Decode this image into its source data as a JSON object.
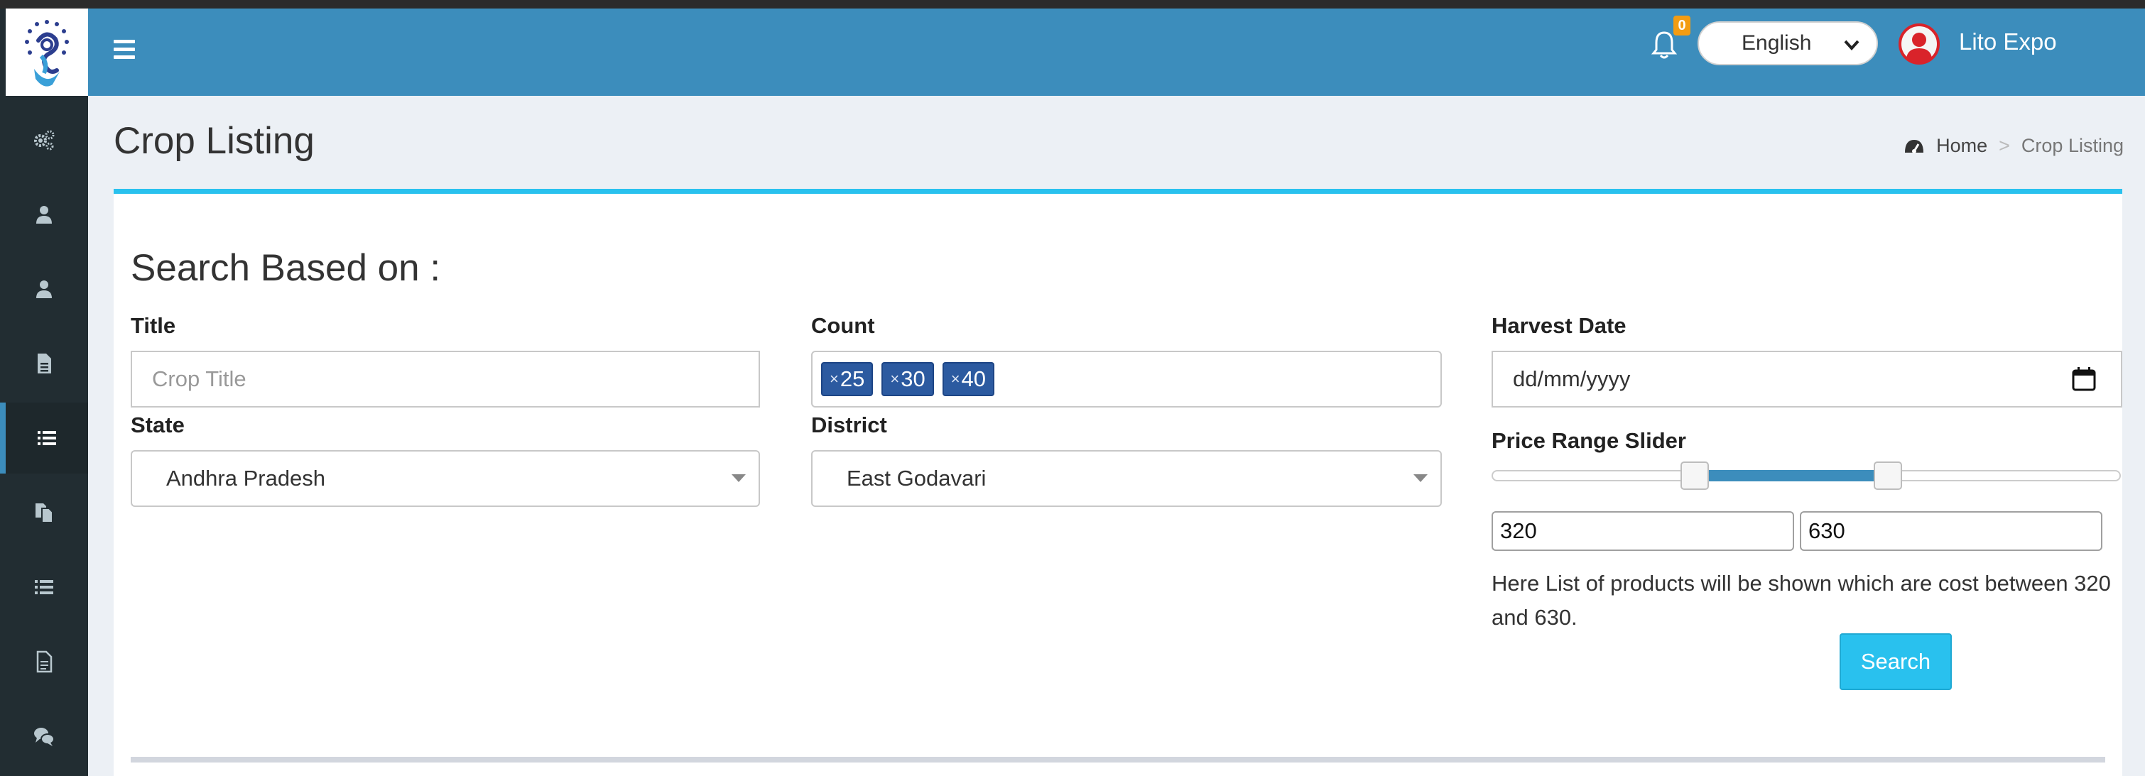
{
  "header": {
    "notification_count": "0",
    "language": "English",
    "user_name": "Lito Expo"
  },
  "page": {
    "title": "Crop Listing",
    "breadcrumb": [
      "Home",
      "Crop Listing"
    ]
  },
  "search": {
    "heading": "Search Based on :",
    "title_label": "Title",
    "title_placeholder": "Crop Title",
    "count_label": "Count",
    "count_chips": [
      "25",
      "30",
      "40"
    ],
    "harvest_label": "Harvest Date",
    "harvest_placeholder": "dd/mm/yyyy",
    "state_label": "State",
    "state_value": "Andhra Pradesh",
    "district_label": "District",
    "district_value": "East Godavari",
    "price_label": "Price Range Slider",
    "price_min": "320",
    "price_max": "630",
    "range_text": "Here List of products will be shown which are cost between 320 and 630.",
    "search_button": "Search"
  },
  "sidebar_icons": [
    "gears-icon",
    "user-icon",
    "user-icon",
    "document-icon",
    "list-icon",
    "copy-icon",
    "list-icon",
    "file-text-icon",
    "chat-icon"
  ],
  "colors": {
    "header": "#3c8dbc",
    "sidebar": "#222d32",
    "accent": "#29c1ee",
    "chip": "#2c5aa0",
    "badge": "#f39c12"
  }
}
